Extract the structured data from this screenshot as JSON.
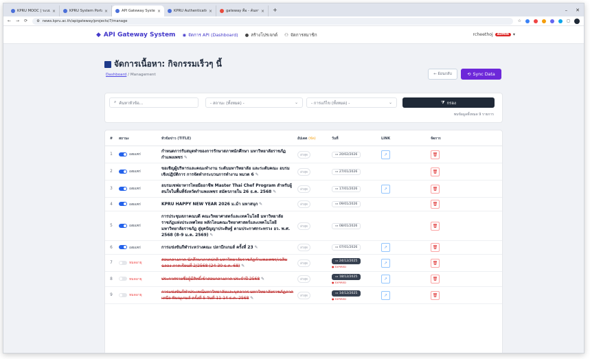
{
  "browser": {
    "tabs": [
      {
        "label": "KPRU MOOC | ระบบจัดการเรียนการ"
      },
      {
        "label": "KPRU System Portal Gallery"
      },
      {
        "label": "API Gateway System",
        "active": true
      },
      {
        "label": "KPRU Authentication"
      },
      {
        "label": "gateway คือ - ค้นหาใน Google"
      }
    ],
    "url": "news.kpru.ac.th/apigateway/projects/7/manage",
    "new_tab": "+",
    "minimize": "–",
    "close": "✕"
  },
  "nav": {
    "brand": "API Gateway System",
    "items": [
      {
        "label": "จัดการ API (Dashboard)",
        "icon": "gauge-icon"
      },
      {
        "label": "สร้างโปรเจกต์",
        "icon": "plus-circle-icon"
      },
      {
        "label": "จัดการสมาชิก",
        "icon": "users-icon"
      }
    ],
    "user": "rcheethoj",
    "badge": "ADMIN"
  },
  "page": {
    "title": "จัดการเนื้อหา: กิจกรรมเร็วๆ นี้",
    "crumb_link": "Dashboard",
    "crumb_sep": " / ",
    "crumb_current": "Management",
    "back_label": "← ย้อนกลับ",
    "sync_label": "Sync Data"
  },
  "filters": {
    "search_placeholder": "ค้นหาหัวข้อ...",
    "status_value": "- สถานะ (ทั้งหมด) -",
    "link_value": "- การแก้ไข (ทั้งหมด) -",
    "filter_button": "กรอง",
    "count_text": "พบข้อมูลทั้งหมด 9 รายการ"
  },
  "table": {
    "headers": [
      "#",
      "สถานะ",
      "หัวข้อข่าว (TITLE)",
      "อัปเดต",
      "วันที่",
      "LINK",
      "จัดการ"
    ],
    "update_suffix": "(ขัด)",
    "rows": [
      {
        "n": "1",
        "on": true,
        "status": "เผยแพร่",
        "title": "กำหนดการรับสมุดทำของการรักษาสภาพนักศึกษา มหาวิทยาลัยราชภัฏกำแพงเพชร",
        "chip": "ล่าสุด",
        "date": "20/02/2026",
        "link": true,
        "expired": false
      },
      {
        "n": "2",
        "on": true,
        "status": "เผยแพร่",
        "title": "ขอเชิญผู้บริหารและคณะทำงาน ระดับมหาวิทยาลัย และระดับคณะ อบรมเชิงปฏิบัติการ การจัดทำกระบวนการทำงาน หมวด 6",
        "chip": "ล่าสุด",
        "date": "27/01/2026",
        "link": false,
        "expired": false
      },
      {
        "n": "3",
        "on": true,
        "status": "เผยแพร่",
        "title": "อบรมเชฟอาหารไทยมืออาชีพ Master Thai Chef Program สำหรับผู้สนใจในพื้นที่จังหวัดกำแพงเพชร สมัครภายใน 26 ธ.ค. 2568",
        "chip": "ล่าสุด",
        "date": "17/01/2026",
        "link": true,
        "expired": false
      },
      {
        "n": "4",
        "on": true,
        "status": "เผยแพร่",
        "title": "KPRU HAPPY NEW YEAR 2026 ม.ม้า มหาสนุก",
        "chip": "ล่าสุด",
        "date": "09/01/2026",
        "link": false,
        "expired": false
      },
      {
        "n": "5",
        "on": true,
        "status": "เผยแพร่",
        "title": "การประชุมสภาคณบดี คณะวิทยาศาสตร์และเทคโนโลยี มหาวิทยาลัยราชภัฏแห่งประเทศไทย หลักโลนคณะวิทยาศาสตร์และเทคโนโลยี มหาวิทยาลัยราชภัฏ สู่ยุคปัญญาประดิษฐ์ ตามประกาศกระทรวง อว. พ.ศ. 2568 (8-9 ม.ค. 2569)",
        "chip": "ล่าสุด",
        "date": "08/01/2026",
        "link": false,
        "expired": false
      },
      {
        "n": "6",
        "on": true,
        "status": "เผยแพร่",
        "title": "การแข่งขันกีฬาระหว่างคณะ ปลาบึกเกมส์ ครั้งที่ 23",
        "chip": "ล่าสุด",
        "date": "07/01/2026",
        "link": true,
        "expired": false
      },
      {
        "n": "7",
        "on": false,
        "status": "หมดอายุ",
        "title": "สอบกลางภาค นักศึกษาภาคปกติ มหาวิทยาลัยราชภัฏกำแพงเพชร/เฉลิมฉลอง ภาคเรียนที่ 2/2568 (24-30 ธ.ค. 68)",
        "chip": "ล่าสุด",
        "date": "24/12/2025",
        "link": true,
        "expired": true
      },
      {
        "n": "8",
        "on": false,
        "status": "หมดอายุ",
        "title": "ประกาศรายชื่อผู้มีสิทธิ์เข้าสอบกลางภาค ประจำปี 2568",
        "chip": "ล่าสุด",
        "date": "18/12/2025",
        "link": true,
        "expired": true
      },
      {
        "n": "9",
        "on": false,
        "status": "หมดอายุ",
        "title": "การแข่งขันกีฬาประเพณีมหาวิทยาลัยและบุคลากร มหาวิทยาลัยราชภัฏภาคเหนือ พิษณุเกมส์ ครั้งที่ 5 วันที่ 11-14 ธ.ค. 2568",
        "chip": "ล่าสุด",
        "date": "14/12/2025",
        "link": true,
        "expired": true
      }
    ],
    "expired_label": "EXPIRED"
  }
}
